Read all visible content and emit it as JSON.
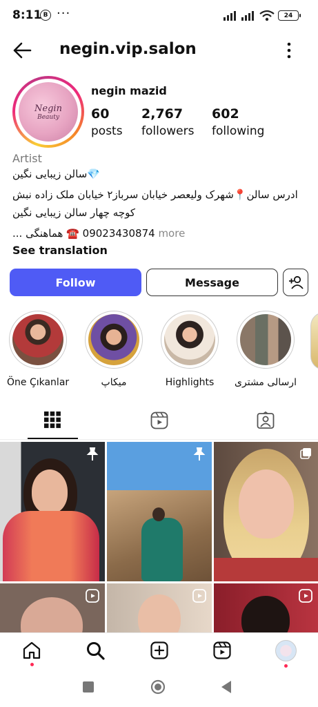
{
  "status_bar": {
    "time": "8:11",
    "dots": "···",
    "battery": "24"
  },
  "header": {
    "username": "negin.vip.salon"
  },
  "profile": {
    "avatar_text_1": "Negin",
    "avatar_text_2": "Beauty",
    "name": "negin mazid",
    "stats": [
      {
        "value": "60",
        "label": "posts"
      },
      {
        "value": "2,767",
        "label": "followers"
      },
      {
        "value": "602",
        "label": "following"
      }
    ],
    "category": "Artist",
    "bio_line_1": "💎سالن زیبایی نگین",
    "bio_line_2": "ادرس سالن📍شهرک ولیعصر خیابان سرباز۲ خیابان ملک زاده نبش",
    "bio_line_3": "کوچه چهار سالن زیبایی نگین",
    "bio_line_4": "09023430874 ☎️ هماهنگی ...",
    "more": "more",
    "see_translation": "See translation"
  },
  "actions": {
    "follow": "Follow",
    "message": "Message"
  },
  "highlights": [
    {
      "label": "Öne Çıkanlar"
    },
    {
      "label": "میکاپ"
    },
    {
      "label": "Highlights"
    },
    {
      "label": "ارسالی مشتری"
    }
  ],
  "colors": {
    "follow_blue": "#4f5bf5",
    "live_dot": "#ff2a55"
  },
  "icons": {
    "tabs": [
      "grid-icon",
      "reels-icon",
      "tagged-icon"
    ],
    "nav": [
      "home-icon",
      "search-icon",
      "create-icon",
      "reels-icon",
      "profile-avatar"
    ]
  }
}
